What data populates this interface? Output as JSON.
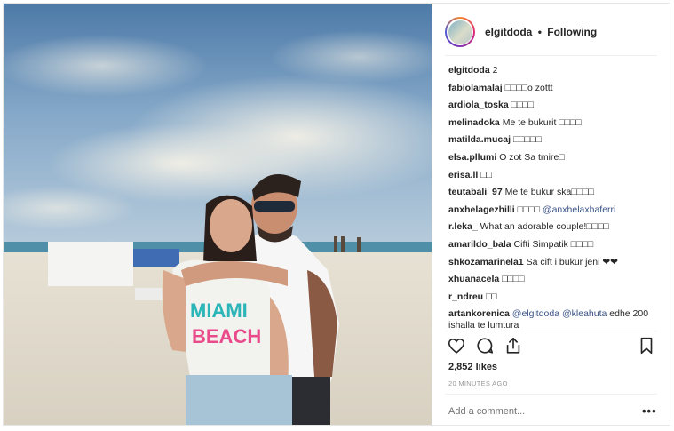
{
  "post": {
    "username": "elgitdoda",
    "separator": "•",
    "follow_status": "Following",
    "caption": {
      "user": "elgitdoda",
      "text": "2"
    },
    "comments": [
      {
        "user": "fabiolamalaj",
        "text": "□□□□o zottt"
      },
      {
        "user": "ardiola_toska",
        "text": "□□□□"
      },
      {
        "user": "melinadoka",
        "text": "Me te bukurit □□□□"
      },
      {
        "user": "matilda.mucaj",
        "text": "□□□□□"
      },
      {
        "user": "elsa.pllumi",
        "text": "O zot Sa tmire□"
      },
      {
        "user": "erisa.ll",
        "text": "□□"
      },
      {
        "user": "teutabali_97",
        "text": "Me te bukur ska□□□□"
      },
      {
        "user": "anxhelagezhilli",
        "text": "□□□□",
        "mention": "@anxhelaxhaferri"
      },
      {
        "user": "r.leka_",
        "text": "What an adorable couple!□□□□"
      },
      {
        "user": "amarildo_bala",
        "text": "Cifti Simpatik □□□□"
      },
      {
        "user": "shkozamarinela1",
        "text": "Sa cift i bukur jeni ❤❤"
      },
      {
        "user": "xhuanacela",
        "text": "□□□□"
      },
      {
        "user": "r_ndreu",
        "text": "□□"
      },
      {
        "user": "artankorenica",
        "mention1": "@elgitdoda",
        "mention2": "@kleahuta",
        "text": "edhe 200 ishalla te lumtura"
      }
    ],
    "likes": "2,852 likes",
    "timestamp": "20 MINUTES AGO",
    "add_comment_placeholder": "Add a comment...",
    "more_label": "•••",
    "photo_text": {
      "line1": "MIAMI",
      "line2": "BEACH"
    },
    "icons": [
      "heart-icon",
      "comment-icon",
      "share-icon",
      "bookmark-icon",
      "more-options-icon"
    ]
  }
}
